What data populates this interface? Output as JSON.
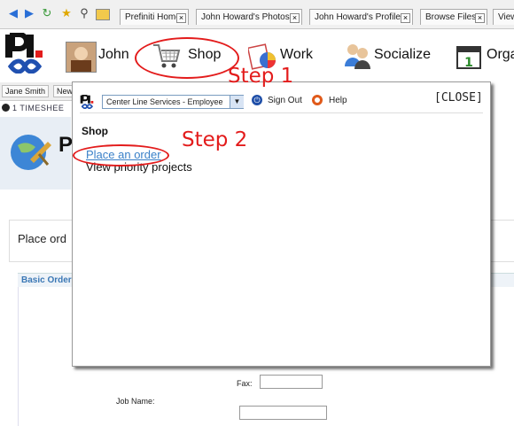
{
  "browser_tabs": [
    {
      "label": "Prefiniti Home"
    },
    {
      "label": "John Howard's Photos"
    },
    {
      "label": "John Howard's Profile"
    },
    {
      "label": "Browse Files"
    },
    {
      "label": "View"
    }
  ],
  "nav": {
    "user_name": "John",
    "shop_label": "Shop",
    "work_label": "Work",
    "socialize_label": "Socialize",
    "organize_label": "Orga"
  },
  "subtabs": [
    "Jane Smith",
    "New"
  ],
  "timesheet_text": "1 TIMESHEE",
  "page_title": "P",
  "order_text": "Place ord",
  "basic_order_label": "Basic Order",
  "form": {
    "fax_label": "Fax:",
    "job_name_label": "Job Name:"
  },
  "popup": {
    "company_select": "Center Line Services - Employee",
    "sign_out": "Sign Out",
    "help": "Help",
    "close": "[CLOSE]",
    "section_title": "Shop",
    "links": [
      {
        "label": "Place an order"
      },
      {
        "label": "View priority projects"
      }
    ]
  },
  "annotations": {
    "step1": "Step 1",
    "step2": "Step 2",
    "color": "#e31c1c"
  }
}
